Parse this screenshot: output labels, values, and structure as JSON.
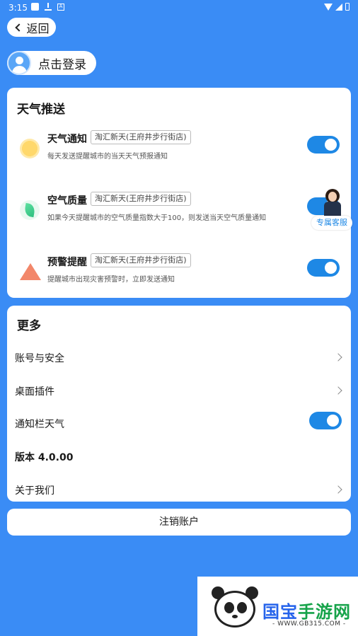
{
  "status_bar": {
    "time": "3:15"
  },
  "nav": {
    "back_label": "返回"
  },
  "account": {
    "login_label": "点击登录"
  },
  "push": {
    "title": "天气推送",
    "items": [
      {
        "name": "天气通知",
        "location": "淘汇新天(王府井步行街店)",
        "desc": "每天发送提醒城市的当天天气预报通知",
        "icon": "sun-icon",
        "enabled": true
      },
      {
        "name": "空气质量",
        "location": "淘汇新天(王府井步行街店)",
        "desc": "如果今天提醒城市的空气质量指数大于100，则发送当天空气质量通知",
        "icon": "leaf-icon",
        "enabled": true
      },
      {
        "name": "预警提醒",
        "location": "淘汇新天(王府井步行街店)",
        "desc": "提醒城市出现灾害预警时，立即发送通知",
        "icon": "warning-icon",
        "enabled": true
      }
    ]
  },
  "customer_service": {
    "label": "专属客服"
  },
  "more": {
    "title": "更多",
    "items": [
      {
        "label": "账号与安全",
        "type": "link"
      },
      {
        "label": "桌面插件",
        "type": "link"
      },
      {
        "label": "通知栏天气",
        "type": "toggle",
        "enabled": true
      },
      {
        "label": "版本 4.0.00",
        "type": "static"
      },
      {
        "label": "关于我们",
        "type": "link"
      }
    ]
  },
  "logout_label": "注销账户",
  "watermark": {
    "title_a": "国宝",
    "title_b": "手游网",
    "url": "- WWW.GB315.COM -"
  },
  "colors": {
    "background": "#3a8cf5",
    "toggle_on": "#1e88e5",
    "card": "#ffffff"
  }
}
